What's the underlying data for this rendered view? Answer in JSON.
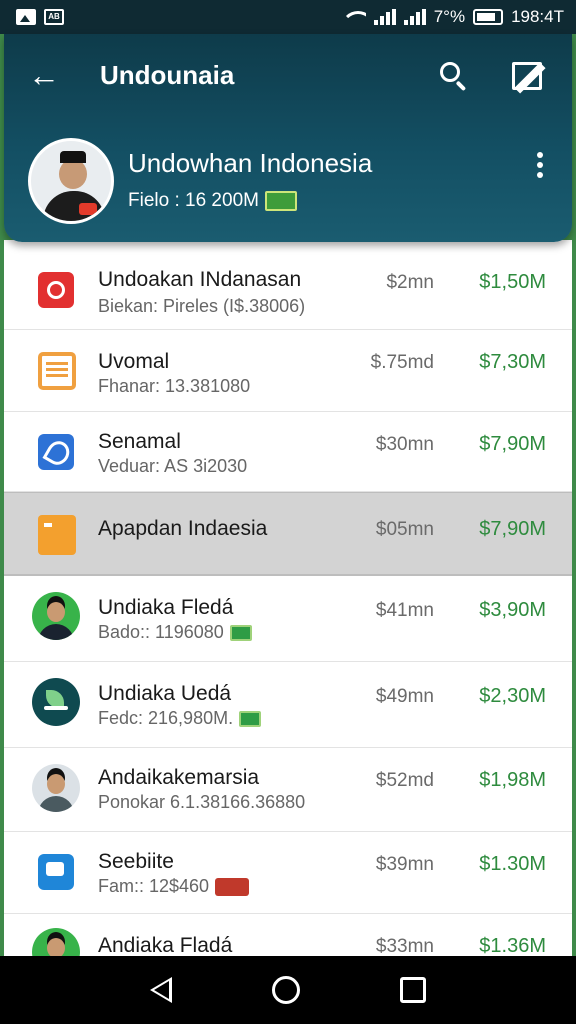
{
  "status_bar": {
    "left_icons": [
      "image-notification-icon",
      "ab-notification-icon"
    ],
    "left_badge_text": "AB",
    "battery_text": "7°%",
    "time": "198:4T"
  },
  "header": {
    "title": "Undounaia",
    "profile_name": "Undowhan Indonesia",
    "profile_subtitle": "Fielo : 16 200M"
  },
  "list": [
    {
      "title": "Undoakan INdanasan",
      "subtitle": "Biekan: Pireles (I$.38006)",
      "amount": "$2mn",
      "value": "$1,50M",
      "icon": "red-circle-icon"
    },
    {
      "title": "Uvomal",
      "subtitle": "Fhanar: 13.381080",
      "amount": "$.75md",
      "value": "$7,30M",
      "icon": "document-icon"
    },
    {
      "title": "Senamal",
      "subtitle": "Veduar: AS 3i2030",
      "amount": "$30mn",
      "value": "$7,90M",
      "icon": "link-icon"
    },
    {
      "title": "Apapdan Indaesia",
      "subtitle": "",
      "amount": "$05mn",
      "value": "$7,90M",
      "icon": "folder-icon",
      "highlighted": true
    },
    {
      "title": "Undiaka Fledá",
      "subtitle": "Bado:: 1196080",
      "amount": "$41mn",
      "value": "$3,90M",
      "icon": "person-avatar-icon"
    },
    {
      "title": "Undiaka Uedá",
      "subtitle": "Fedc: 216,980M.",
      "amount": "$49mn",
      "value": "$2,30M",
      "icon": "leaf-icon"
    },
    {
      "title": "Andaikakemarsia",
      "subtitle": "Ponokar 6.1.38166.36880",
      "amount": "$52md",
      "value": "$1,98M",
      "icon": "person-avatar-icon"
    },
    {
      "title": "Seebiite",
      "subtitle": "Fam:: 12$460",
      "amount": "$39mn",
      "value": "$1.30M",
      "icon": "chat-icon"
    },
    {
      "title": "Andiaka Fladá",
      "subtitle": "",
      "amount": "$33mn",
      "value": "$1.36M",
      "icon": "person-avatar-icon"
    }
  ],
  "colors": {
    "header": "#134f63",
    "value_green": "#2e8b3e",
    "highlight_row": "#d3d3d3",
    "status_bar": "#0f2a33"
  }
}
